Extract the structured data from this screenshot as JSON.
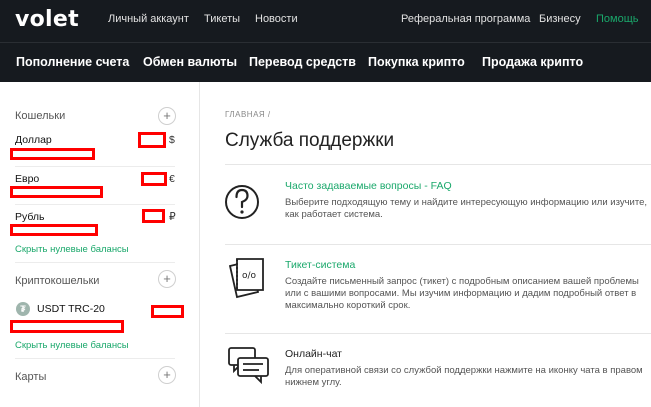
{
  "header": {
    "logo": "volet",
    "nav_left": [
      "Личный аккаунт",
      "Тикеты",
      "Новости"
    ],
    "nav_right": [
      "Реферальная программа",
      "Бизнесу",
      "Помощь"
    ],
    "accent_color": "#1aa86b"
  },
  "main_nav": [
    "Пополнение счета",
    "Обмен валюты",
    "Перевод средств",
    "Покупка крипто",
    "Продажа крипто"
  ],
  "sidebar": {
    "wallets_label": "Кошельки",
    "wallets": [
      {
        "name": "Доллар",
        "symbol": "$"
      },
      {
        "name": "Евро",
        "symbol": "€"
      },
      {
        "name": "Рубль",
        "symbol": "₽"
      }
    ],
    "hide_zero_label": "Скрыть нулевые балансы",
    "crypto_label": "Криптокошельки",
    "crypto_wallets": [
      {
        "name": "USDT TRC-20",
        "icon": "tether-icon"
      }
    ],
    "crypto_hide_zero_label": "Скрыть нулевые балансы",
    "cards_label": "Карты",
    "add_glyph": "+"
  },
  "content": {
    "breadcrumb": "ГЛАВНАЯ /",
    "title": "Служба поддержки",
    "cards": [
      {
        "title": "Часто задаваемые вопросы - FAQ",
        "desc": "Выберите подходящую тему и найдите интересующую информацию или изучите, как работает система.",
        "icon": "question-icon"
      },
      {
        "title": "Тикет-система",
        "desc": "Создайте письменный запрос (тикет) с подробным описанием вашей проблемы или с вашими вопросами. Мы изучим информацию и дадим подробный ответ в максимально короткий срок.",
        "icon": "ticket-icon"
      },
      {
        "title": "Онлайн-чат",
        "desc": "Для оперативной связи со службой поддержки нажмите на иконку чата в правом нижнем углу.",
        "icon": "chat-icon"
      }
    ]
  }
}
